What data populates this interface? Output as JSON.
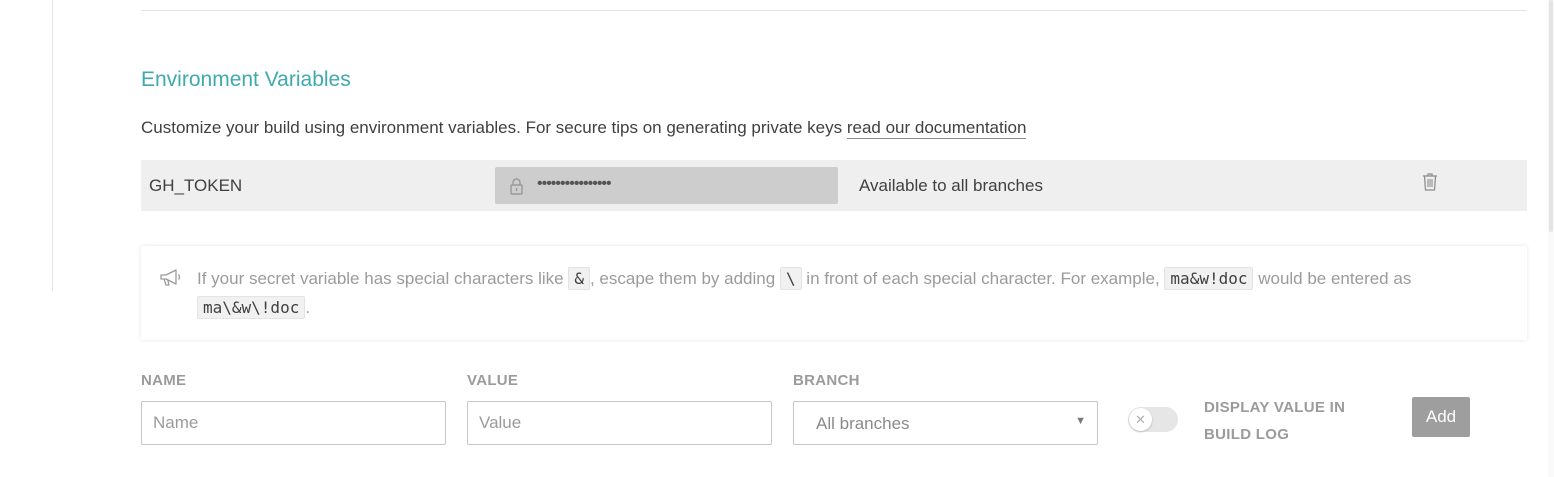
{
  "section": {
    "title": "Environment Variables",
    "description": "Customize your build using environment variables. For secure tips on generating private keys ",
    "doc_link": "read our documentation"
  },
  "variables": [
    {
      "name": "GH_TOKEN",
      "value_masked": "••••••••••••••••",
      "scope": "Available to all branches"
    }
  ],
  "notice": {
    "t1": "If your secret variable has special characters like ",
    "c1": "&",
    "t2": ", escape them by adding ",
    "c2": "\\",
    "t3": " in front of each special character. For example, ",
    "c3": "ma&w!doc",
    "t4": " would be entered as ",
    "c4": "ma\\&w\\!doc",
    "t5": "."
  },
  "form": {
    "name_label": "NAME",
    "name_placeholder": "Name",
    "value_label": "VALUE",
    "value_placeholder": "Value",
    "branch_label": "BRANCH",
    "branch_selected": "All branches",
    "display_label": "DISPLAY VALUE IN BUILD LOG",
    "display_toggle_on": false,
    "add_label": "Add"
  },
  "colors": {
    "accent": "#3eaaaf",
    "row_bg": "#efefef",
    "button_bg": "#9e9e9e"
  },
  "icons": [
    "lock-icon",
    "trash-icon",
    "megaphone-icon",
    "chevron-down-icon",
    "close-icon"
  ]
}
